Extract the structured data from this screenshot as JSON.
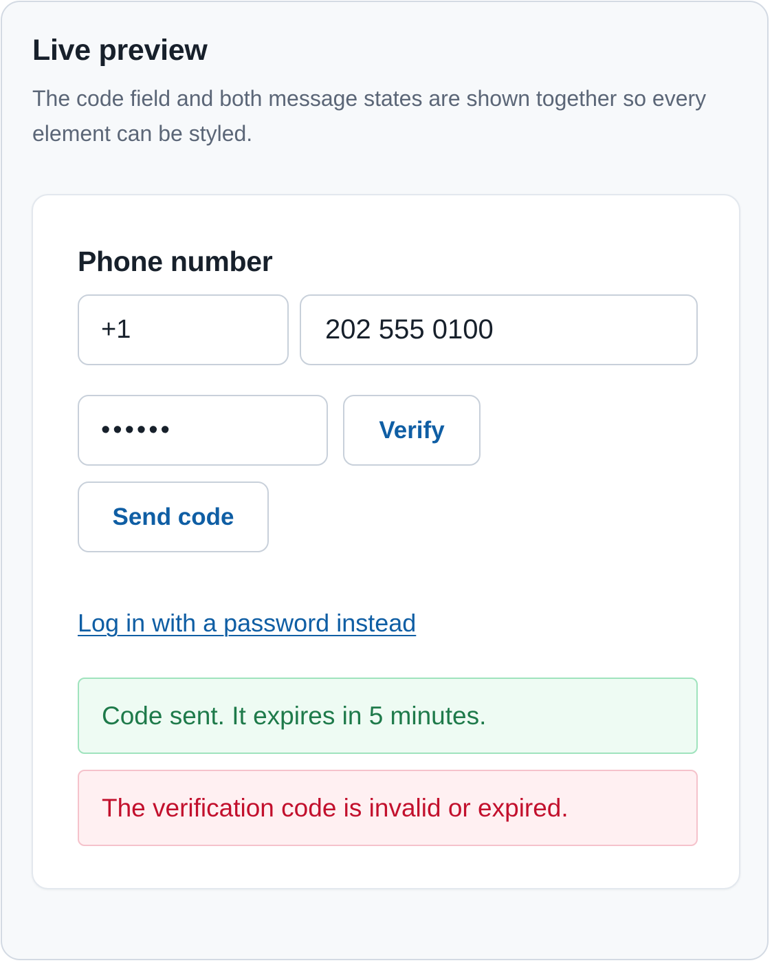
{
  "panel": {
    "title": "Live preview",
    "description": "The code field and both message states are shown together so every element can be styled."
  },
  "form": {
    "phone_label": "Phone number",
    "country_code_value": "+1",
    "phone_value": "202 555 0100",
    "code_value": "123456",
    "verify_label": "Verify",
    "send_code_label": "Send code",
    "password_link": "Log in with a password instead"
  },
  "messages": {
    "success": "Code sent. It expires in 5 minutes.",
    "error": "The verification code is invalid or expired."
  },
  "colors": {
    "accent": "#0f5ea4",
    "success_text": "#1e7a4a",
    "success_bg": "#eefbf3",
    "error_text": "#c2102d",
    "error_bg": "#fff0f2"
  }
}
